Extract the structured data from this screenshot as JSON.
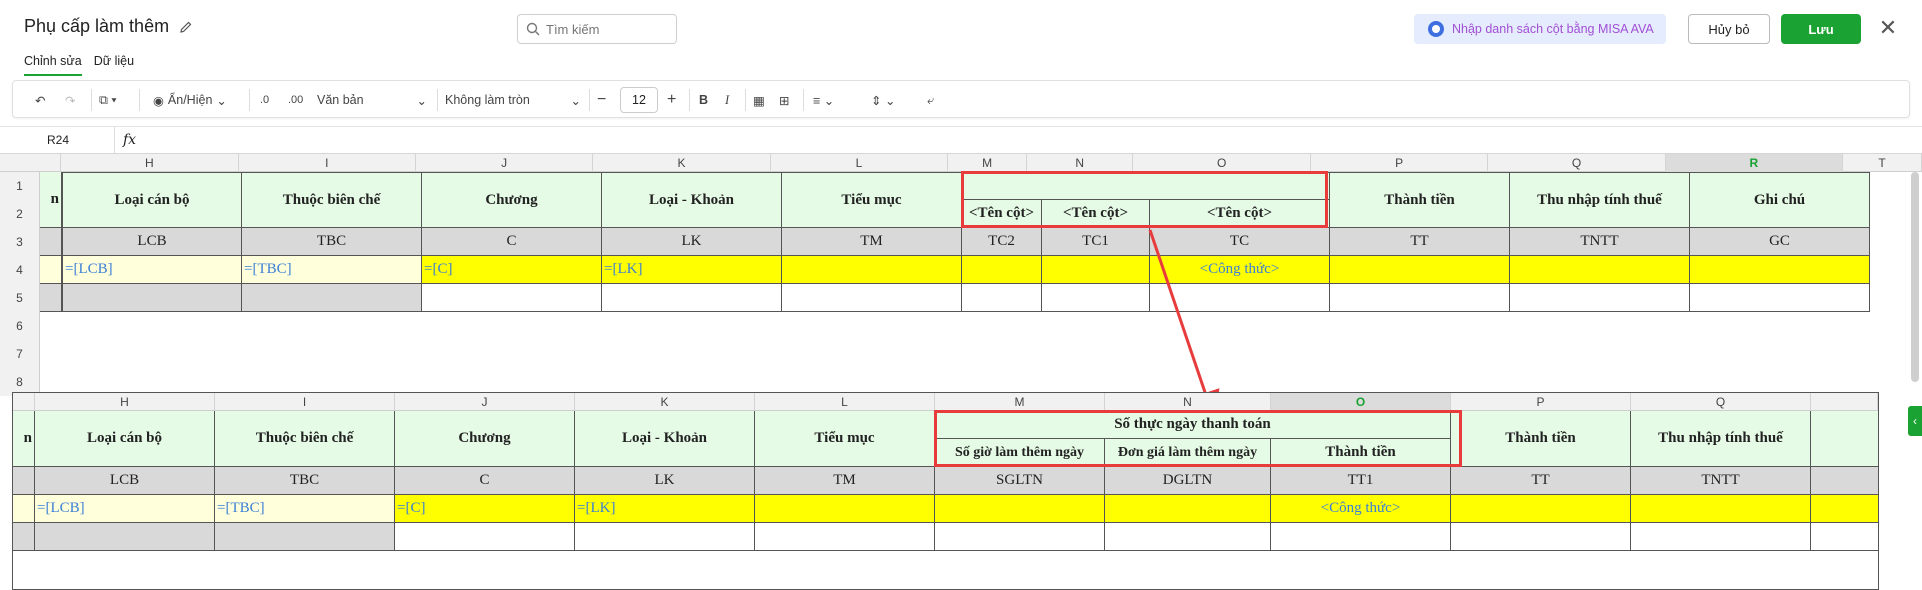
{
  "header": {
    "title": "Phụ cấp làm thêm",
    "search_placeholder": "Tìm kiếm",
    "ava_label": "Nhập danh sách cột bằng MISA AVA",
    "cancel_label": "Hủy bỏ",
    "save_label": "Lưu"
  },
  "tabs": [
    "Chỉnh sửa",
    "Dữ liệu"
  ],
  "toolbar": {
    "show_hide": "Ẩn/Hiện",
    "decrease_decimal": ".0",
    "increase_decimal": ".00",
    "format": "Văn bản",
    "rounding": "Không làm tròn",
    "font_size": "12"
  },
  "formula_bar": {
    "cell_ref": "R24",
    "fx": "fx"
  },
  "top_sheet": {
    "columns": [
      "H",
      "I",
      "J",
      "K",
      "L",
      "M",
      "N",
      "O",
      "P",
      "Q",
      "R",
      "T"
    ],
    "rows": [
      "1",
      "2",
      "3",
      "4",
      "5",
      "6",
      "7",
      "8"
    ],
    "headers": {
      "H": "Loại cán bộ",
      "I": "Thuộc biên chế",
      "J": "Chương",
      "K": "Loại - Khoản",
      "L": "Tiểu mục",
      "P": "Thành tiền",
      "Q": "Thu nhập tính thuế",
      "R": "Ghi chú"
    },
    "sub_headers": {
      "M": "<Tên cột>",
      "N": "<Tên cột>",
      "O": "<Tên cột>"
    },
    "codes": {
      "H": "LCB",
      "I": "TBC",
      "J": "C",
      "K": "LK",
      "L": "TM",
      "M": "TC2",
      "N": "TC1",
      "O": "TC",
      "P": "TT",
      "Q": "TNTT",
      "R": "GC"
    },
    "formulas": {
      "H": "=[LCB]",
      "I": "=[TBC]",
      "J": "=[C]",
      "K": "=[LK]",
      "O": "<Công thức>"
    },
    "row1_partial": "n"
  },
  "bottom_sheet": {
    "columns": [
      "H",
      "I",
      "J",
      "K",
      "L",
      "M",
      "N",
      "O",
      "P",
      "Q"
    ],
    "headers": {
      "H": "Loại cán bộ",
      "I": "Thuộc biên chế",
      "J": "Chương",
      "K": "Loại - Khoản",
      "L": "Tiểu mục",
      "P": "Thành tiền",
      "Q": "Thu nhập tính thuế"
    },
    "group_header": "Số thực ngày thanh toán",
    "sub_headers": {
      "M": "Số giờ làm thêm ngày",
      "N": "Đơn giá làm thêm ngày",
      "O": "Thành tiền"
    },
    "codes": {
      "H": "LCB",
      "I": "TBC",
      "J": "C",
      "K": "LK",
      "L": "TM",
      "M": "SGLTN",
      "N": "DGLTN",
      "O": "TT1",
      "P": "TT",
      "Q": "TNTT"
    },
    "formulas": {
      "H": "=[LCB]",
      "I": "=[TBC]",
      "J": "=[C]",
      "K": "=[LK]",
      "O": "<Công thức>"
    },
    "row_partial": "n"
  },
  "colors": {
    "accent": "#1aa233",
    "highlight": "#e83c3c",
    "formula_bg": "#ffff00",
    "header_bg": "#e6fbe6",
    "ava_text": "#a34fd6"
  },
  "icons": [
    "pencil-icon",
    "search-icon",
    "ava-icon",
    "close-icon",
    "undo-icon",
    "redo-icon",
    "copy-icon",
    "eye-icon",
    "bold-icon",
    "italic-icon",
    "border-icon",
    "merge-icon",
    "align-icon",
    "valign-icon",
    "wrap-icon"
  ]
}
